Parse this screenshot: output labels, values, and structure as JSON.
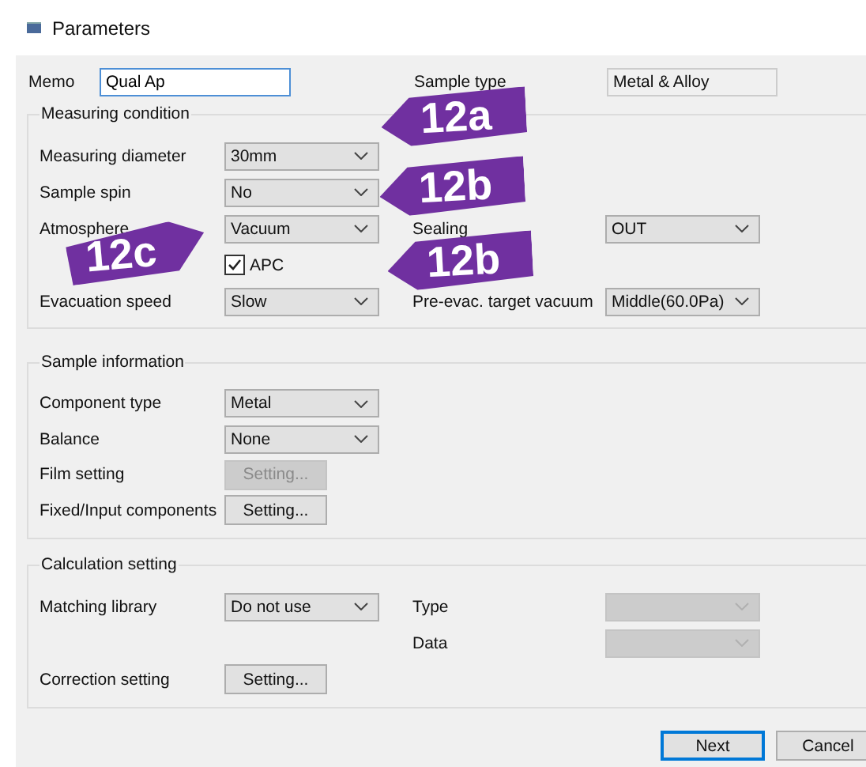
{
  "window": {
    "title": "Parameters"
  },
  "memo": {
    "label": "Memo",
    "value": "Qual Ap"
  },
  "sample_type": {
    "label": "Sample type",
    "value": "Metal & Alloy"
  },
  "groups": [
    {
      "title": "Measuring condition",
      "rows": [
        {
          "label": "Measuring diameter",
          "control": {
            "kind": "combo",
            "value": "30mm",
            "disabled": false
          }
        },
        {
          "label": "Sample spin",
          "control": {
            "kind": "combo",
            "value": "No",
            "disabled": false
          }
        },
        {
          "label": "Atmosphere",
          "control": {
            "kind": "combo",
            "value": "Vacuum",
            "disabled": false
          },
          "right": {
            "label": "Sealing",
            "control": {
              "kind": "combo",
              "value": "OUT",
              "disabled": false
            }
          }
        },
        {
          "control": {
            "kind": "checkbox",
            "label": "APC",
            "checked": true
          }
        },
        {
          "label": "Evacuation speed",
          "control": {
            "kind": "combo",
            "value": "Slow",
            "disabled": false
          },
          "right": {
            "label": "Pre-evac. target vacuum",
            "control": {
              "kind": "combo",
              "value": "Middle(60.0Pa)",
              "disabled": false
            }
          }
        }
      ]
    },
    {
      "title": "Sample information",
      "rows": [
        {
          "label": "Component type",
          "control": {
            "kind": "combo",
            "value": "Metal",
            "disabled": false
          }
        },
        {
          "label": "Balance",
          "control": {
            "kind": "combo",
            "value": "None",
            "disabled": false
          }
        },
        {
          "label": "Film setting",
          "control": {
            "kind": "button",
            "label": "Setting...",
            "disabled": true
          }
        },
        {
          "label": "Fixed/Input components",
          "control": {
            "kind": "button",
            "label": "Setting...",
            "disabled": false
          }
        }
      ]
    },
    {
      "title": "Calculation setting",
      "rows": [
        {
          "label": "Matching library",
          "control": {
            "kind": "combo",
            "value": "Do not use",
            "disabled": false
          },
          "right": {
            "label": "Type",
            "control": {
              "kind": "combo",
              "disabled": true
            }
          }
        },
        {
          "right": {
            "label": "Data",
            "control": {
              "kind": "combo",
              "disabled": true
            }
          }
        },
        {
          "label": "Correction setting",
          "control": {
            "kind": "button",
            "label": "Setting...",
            "disabled": false
          }
        }
      ]
    }
  ],
  "buttons": [
    {
      "label": "Next",
      "default": true
    },
    {
      "label": "Cancel",
      "default": false
    }
  ],
  "callouts": [
    {
      "text": "12a",
      "kind": "pointer_left"
    },
    {
      "text": "12b",
      "kind": "pointer_left"
    },
    {
      "text": "12c",
      "kind": "pointer_right"
    },
    {
      "text": "12b",
      "kind": "pointer_left"
    }
  ]
}
